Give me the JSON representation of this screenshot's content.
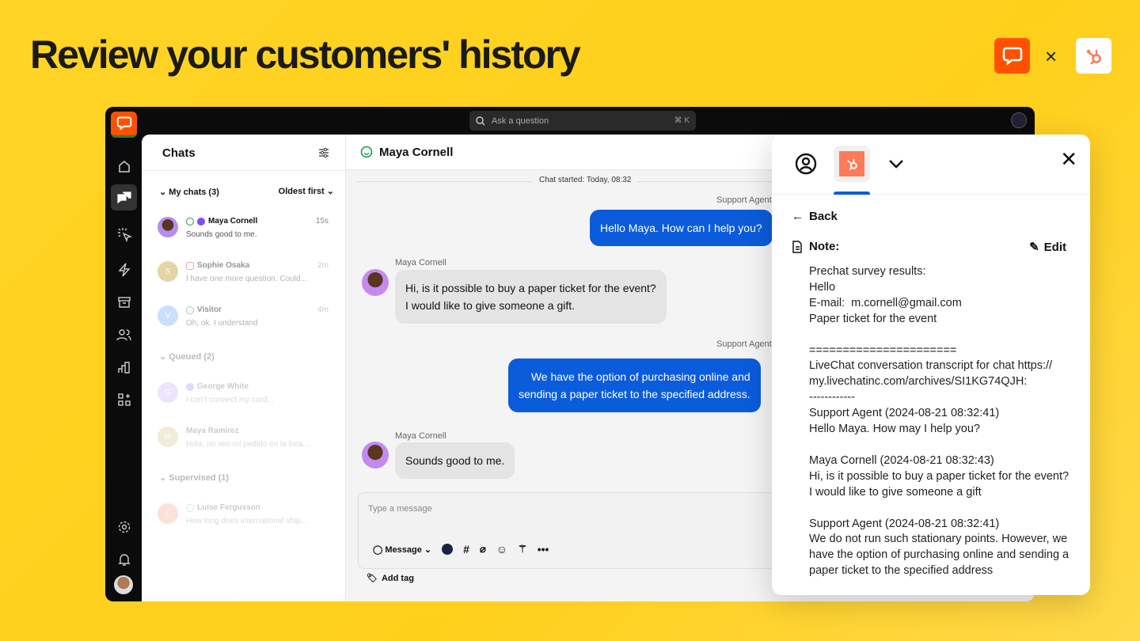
{
  "headline": "Review your customers' history",
  "brand_separator": "×",
  "topbar": {
    "search_placeholder": "Ask a question",
    "shortcut": "⌘ K"
  },
  "sidebar": {
    "items": [
      {
        "icon": "home-icon"
      },
      {
        "icon": "chats-icon",
        "active": true
      },
      {
        "icon": "engage-icon"
      },
      {
        "icon": "automate-icon"
      },
      {
        "icon": "archives-icon"
      },
      {
        "icon": "team-icon"
      },
      {
        "icon": "reports-icon"
      },
      {
        "icon": "apps-icon"
      },
      {
        "icon": "settings-icon"
      },
      {
        "icon": "notifications-icon"
      }
    ]
  },
  "chats": {
    "title": "Chats",
    "my_chats": "My chats (3)",
    "sort": "Oldest first",
    "queued": "Queued (2)",
    "supervised": "Supervised (1)",
    "items": [
      {
        "initial": "",
        "name": "Maya Cornell",
        "preview": "Sounds good to me.",
        "time": "15s",
        "color": "#b58cf0"
      },
      {
        "initial": "S",
        "name": "Sophie Osaka",
        "preview": "I have one more question. Could...",
        "time": "2m",
        "color": "#c2a43a"
      },
      {
        "initial": "V",
        "name": "Visitor",
        "preview": "Oh, ok. I understand",
        "time": "4m",
        "color": "#8ab9f7"
      },
      {
        "initial": "G",
        "name": "George White",
        "preview": "I can't connect my card...",
        "time": "",
        "color": "#c9b6f5"
      },
      {
        "initial": "M",
        "name": "Maya Ramirez",
        "preview": "Hola, no veo mi pedido en la lista...",
        "time": "",
        "color": "#d6cb8e"
      },
      {
        "initial": "L",
        "name": "Luise  Fergusson",
        "preview": "How long does international ship...",
        "time": "",
        "color": "#f5a68a"
      }
    ]
  },
  "conversation": {
    "name": "Maya Cornell",
    "started": "Chat started: Today, 08:32",
    "agent_label": "Support Agent",
    "customer_label": "Maya Cornell",
    "messages": [
      {
        "from": "agent",
        "text": "Hello Maya. How can I help you?"
      },
      {
        "from": "customer",
        "text": "Hi, is it possible to buy a paper ticket for the event?\nI would like to give someone a gift."
      },
      {
        "from": "agent",
        "text": "We have the option of purchasing online and\nsending a paper ticket to the specified address."
      },
      {
        "from": "customer",
        "text": "Sounds good to me."
      }
    ],
    "composer_placeholder": "Type a message",
    "message_mode": "Message",
    "add_tag": "Add tag"
  },
  "panel": {
    "back": "Back",
    "note_label": "Note:",
    "edit": "Edit",
    "note_body": "Prechat survey results:\nHello\nE-mail:  m.cornell@gmail.com\nPaper ticket for the event\n\n======================\nLiveChat conversation transcript for chat https://\nmy.livechatinc.com/archives/SI1KG74QJH:\n------------\nSupport Agent (2024-08-21 08:32:41)\nHello Maya. How may I help you?\n\nMaya Cornell (2024-08-21 08:32:43)\nHi, is it possible to buy a paper ticket for the event?\nI would like to give someone a gift\n\nSupport Agent (2024-08-21 08:32:41)\nWe do not run such stationary points. However, we\nhave the option of purchasing online and sending a\npaper ticket to the specified address"
  },
  "colors": {
    "background": "#FFD21F",
    "livechat": "#FF5100",
    "hubspot": "#FF7A59",
    "agent_bubble": "#0B5CDB"
  }
}
